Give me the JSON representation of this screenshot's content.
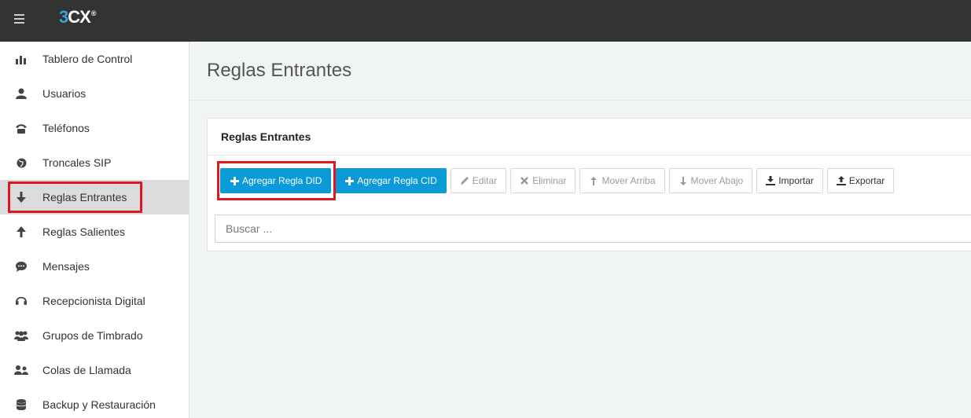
{
  "logo": {
    "text_a": "3",
    "text_b": "CX",
    "mark": "®"
  },
  "sidebar": {
    "items": [
      {
        "label": "Tablero de Control",
        "icon": "bar-chart-icon"
      },
      {
        "label": "Usuarios",
        "icon": "user-icon"
      },
      {
        "label": "Teléfonos",
        "icon": "phone-icon"
      },
      {
        "label": "Troncales SIP",
        "icon": "globe-icon"
      },
      {
        "label": "Reglas Entrantes",
        "icon": "arrow-down-icon",
        "active": true
      },
      {
        "label": "Reglas Salientes",
        "icon": "arrow-up-icon"
      },
      {
        "label": "Mensajes",
        "icon": "chat-icon"
      },
      {
        "label": "Recepcionista Digital",
        "icon": "headset-icon"
      },
      {
        "label": "Grupos de Timbrado",
        "icon": "group-icon"
      },
      {
        "label": "Colas de Llamada",
        "icon": "queue-icon"
      },
      {
        "label": "Backup y Restauración",
        "icon": "database-icon"
      }
    ]
  },
  "page": {
    "title": "Reglas Entrantes"
  },
  "panel": {
    "title": "Reglas Entrantes",
    "buttons": {
      "add_did": "Agregar Regla DID",
      "add_cid": "Agregar Regla CID",
      "edit": "Editar",
      "delete": "Eliminar",
      "move_up": "Mover Arriba",
      "move_down": "Mover Abajo",
      "import": "Importar",
      "export": "Exportar"
    },
    "search": {
      "placeholder": "Buscar ...",
      "value": ""
    }
  },
  "colors": {
    "accent": "#0a9ad8",
    "highlight": "#e0171f",
    "topbar": "#333333"
  }
}
